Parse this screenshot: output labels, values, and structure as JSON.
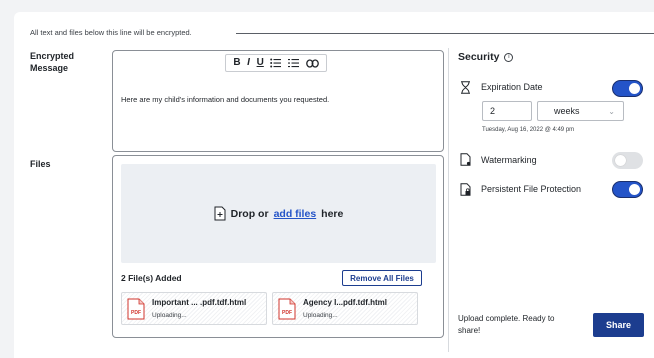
{
  "notice": "All text and files below this line will be encrypted.",
  "message": {
    "label_line1": "Encrypted",
    "label_line2": "Message",
    "toolbar": {
      "bold": "B",
      "italic": "I",
      "underline": "U"
    },
    "text": "Here are my child's information and documents you requested."
  },
  "files": {
    "label": "Files",
    "drop_prefix": "Drop or",
    "drop_link": "add files",
    "drop_suffix": "here",
    "added_count": "2 File(s) Added",
    "remove_all": "Remove All Files",
    "items": [
      {
        "name": "Important ... .pdf.tdf.html",
        "status": "Uploading...",
        "type": "PDF"
      },
      {
        "name": "Agency I...pdf.tdf.html",
        "status": "Uploading...",
        "type": "PDF"
      }
    ]
  },
  "security": {
    "title": "Security",
    "info_glyph": "i",
    "expiration": {
      "label": "Expiration Date",
      "enabled": true,
      "amount": "2",
      "unit": "weeks",
      "date_text": "Tuesday, Aug 16, 2022 @ 4:49 pm"
    },
    "watermarking": {
      "label": "Watermarking",
      "enabled": false
    },
    "persistent": {
      "label": "Persistent File Protection",
      "enabled": true
    }
  },
  "footer": {
    "status": "Upload complete. Ready to share!",
    "share_label": "Share"
  },
  "colors": {
    "accent": "#1c3d8f",
    "link": "#2454c8",
    "toggle_on": "#2454c8",
    "toggle_off": "#dfe1e4"
  },
  "icons": [
    "bold-icon",
    "italic-icon",
    "underline-icon",
    "bullet-list-icon",
    "numbered-list-icon",
    "link-icon",
    "file-add-icon",
    "pdf-icon",
    "info-icon",
    "hourglass-icon",
    "watermark-file-icon",
    "protected-file-icon"
  ]
}
